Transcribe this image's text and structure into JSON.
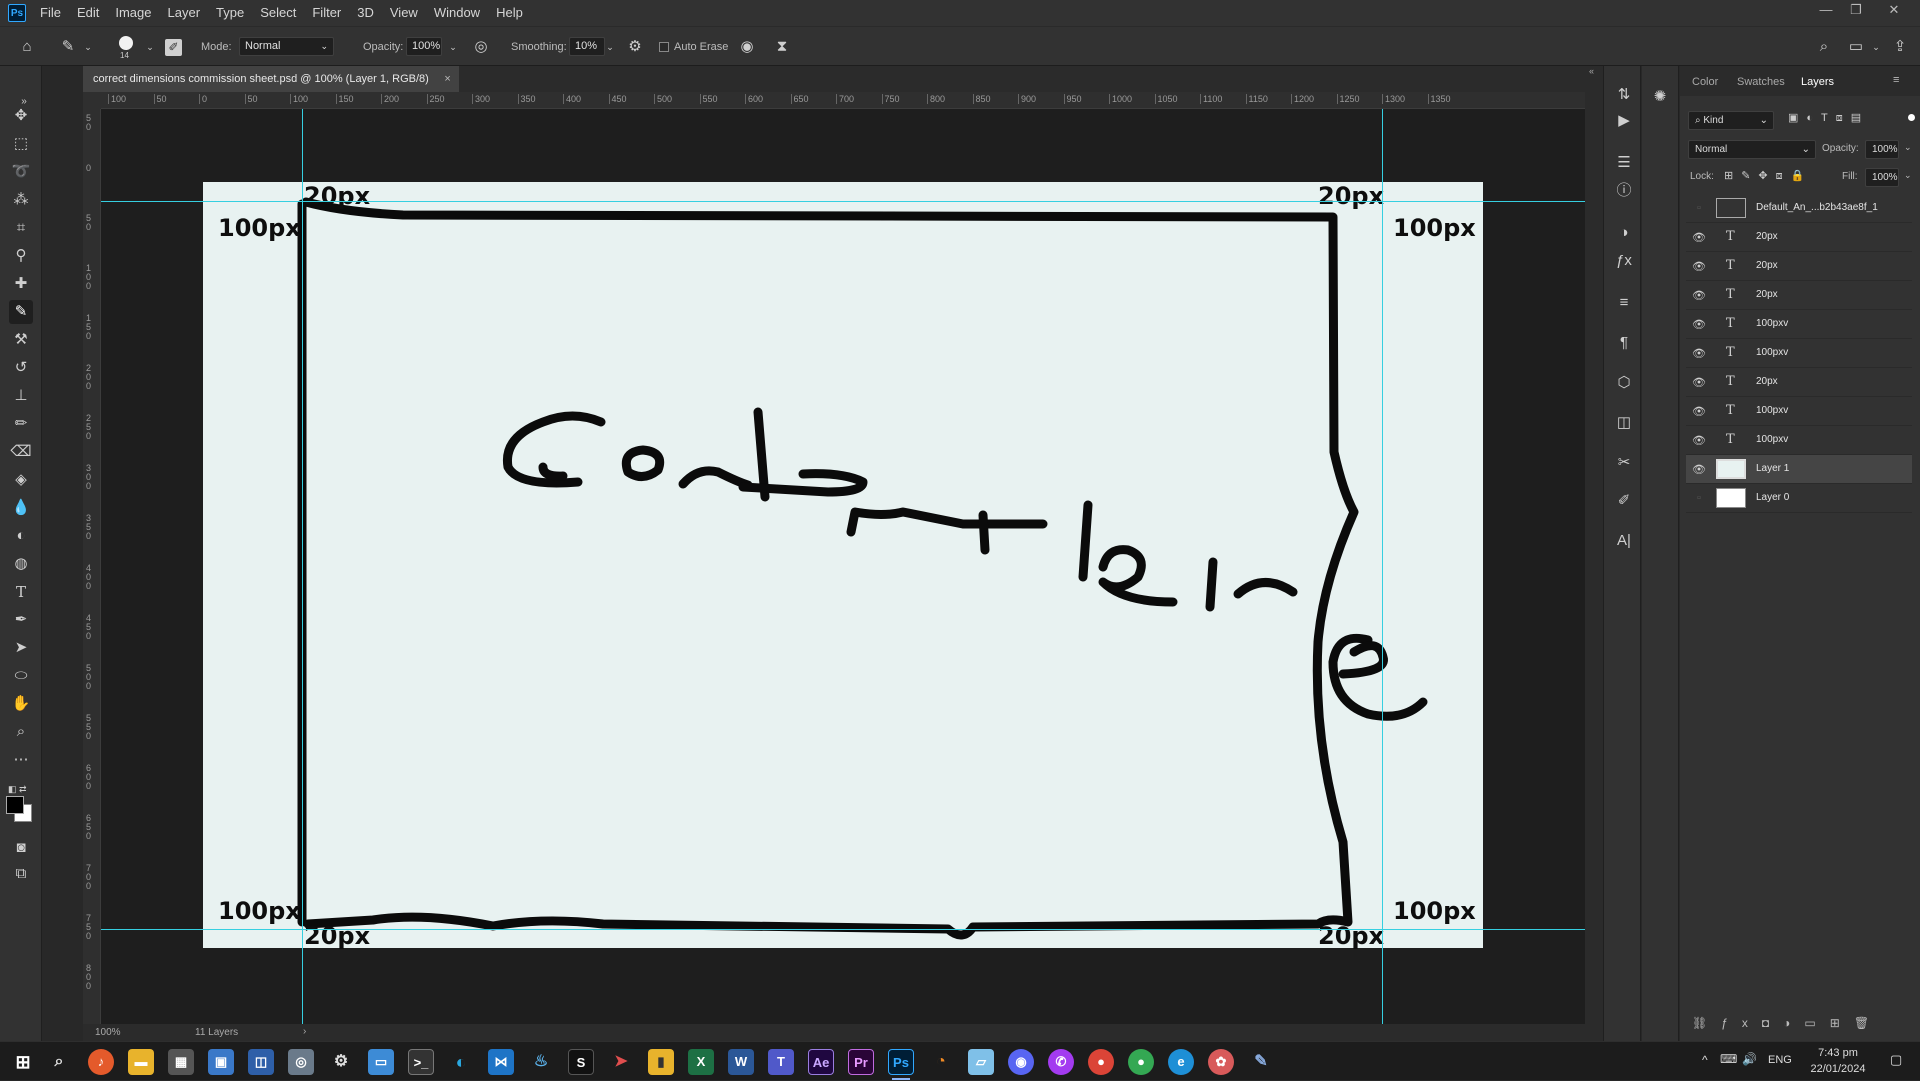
{
  "app": {
    "logo_text": "Ps",
    "menus": [
      "File",
      "Edit",
      "Image",
      "Layer",
      "Type",
      "Select",
      "Filter",
      "3D",
      "View",
      "Window",
      "Help"
    ],
    "window_controls": {
      "minimize": "—",
      "restore": "❐",
      "close": "✕"
    }
  },
  "options_bar": {
    "brush_size": "14",
    "mode_label": "Mode:",
    "mode_value": "Normal",
    "opacity_label": "Opacity:",
    "opacity_value": "100%",
    "smoothing_label": "Smoothing:",
    "smoothing_value": "10%",
    "auto_erase_label": "Auto Erase",
    "auto_erase_checked": false
  },
  "document": {
    "tab_title": "correct dimensions commission sheet.psd @ 100% (Layer 1, RGB/8)",
    "tab_close": "×",
    "zoom": "100%",
    "layer_count": "11 Layers"
  },
  "rulers": {
    "horizontal_ticks": [
      "100",
      "50",
      "0",
      "50",
      "100",
      "150",
      "200",
      "250",
      "300",
      "350",
      "400",
      "450",
      "500",
      "550",
      "600",
      "650",
      "700",
      "750",
      "800",
      "850",
      "900",
      "950",
      "1000",
      "1050",
      "1100",
      "1150",
      "1200",
      "1250",
      "1300",
      "1350"
    ],
    "vertical_ticks": [
      "50",
      "0",
      "50",
      "100",
      "150",
      "200",
      "250",
      "300",
      "350",
      "400",
      "450",
      "500",
      "550",
      "600",
      "650",
      "700",
      "750",
      "800"
    ]
  },
  "artwork": {
    "labels": {
      "top_left_20": "20px",
      "top_right_20": "20px",
      "left_top_100": "100px",
      "right_top_100": "100px",
      "left_bottom_100": "100px",
      "right_bottom_100": "100px",
      "bottom_left_20": "20px",
      "bottom_right_20": "20px"
    },
    "handwriting": "Content here"
  },
  "layers_panel": {
    "tabs": [
      "Color",
      "Swatches",
      "Layers"
    ],
    "active_tab": "Layers",
    "filter_label": "Kind",
    "blend_mode": "Normal",
    "opacity_label": "Opacity:",
    "opacity_value": "100%",
    "lock_label": "Lock:",
    "fill_label": "Fill:",
    "fill_value": "100%",
    "layers": [
      {
        "name": "Default_An_...b2b43ae8f_1",
        "kind": "smart",
        "visible": false
      },
      {
        "name": "20px",
        "kind": "text",
        "visible": true
      },
      {
        "name": "20px",
        "kind": "text",
        "visible": true
      },
      {
        "name": "20px",
        "kind": "text",
        "visible": true
      },
      {
        "name": "100pxv",
        "kind": "text",
        "visible": true
      },
      {
        "name": "100pxv",
        "kind": "text",
        "visible": true
      },
      {
        "name": "20px",
        "kind": "text",
        "visible": true
      },
      {
        "name": "100pxv",
        "kind": "text",
        "visible": true
      },
      {
        "name": "100pxv",
        "kind": "text",
        "visible": true
      },
      {
        "name": "Layer 1",
        "kind": "pixel",
        "visible": true,
        "selected": true
      },
      {
        "name": "Layer 0",
        "kind": "pixel",
        "visible": false
      }
    ]
  },
  "taskbar": {
    "language": "ENG",
    "time": "7:43 pm",
    "date": "22/01/2024"
  },
  "colors": {
    "accent": "#31a8ff",
    "guide": "#36cfe0",
    "selected_layer": "#454545"
  }
}
